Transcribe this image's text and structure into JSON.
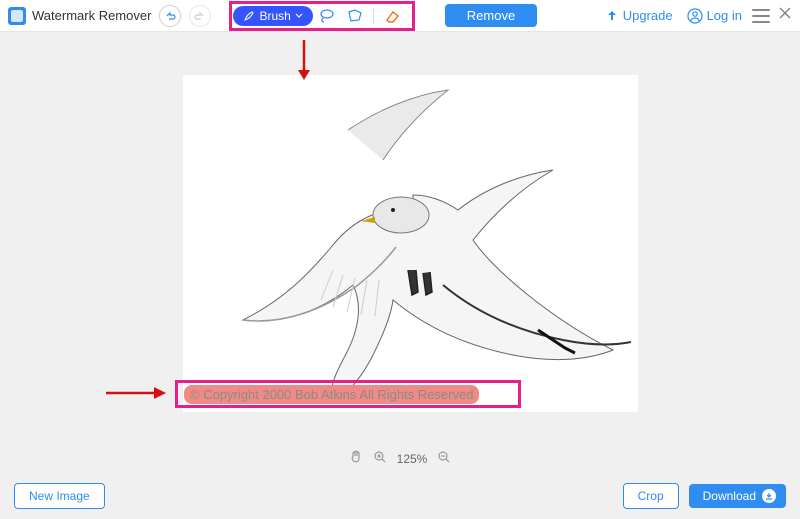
{
  "app": {
    "title": "Watermark Remover"
  },
  "toolbar": {
    "brush": "Brush",
    "tools": [
      "lasso",
      "polygon",
      "eraser"
    ],
    "remove": "Remove"
  },
  "header": {
    "upgrade": "Upgrade",
    "login": "Log in"
  },
  "zoom": {
    "level": "125%"
  },
  "footer": {
    "new_image": "New Image",
    "crop": "Crop",
    "download": "Download"
  },
  "watermark": {
    "text": "© Copyright  2000  Bob Atkins  All Rights Reserved"
  },
  "annotations": {
    "highlight_color": "#e61f8c",
    "arrow_color": "#d41010"
  }
}
